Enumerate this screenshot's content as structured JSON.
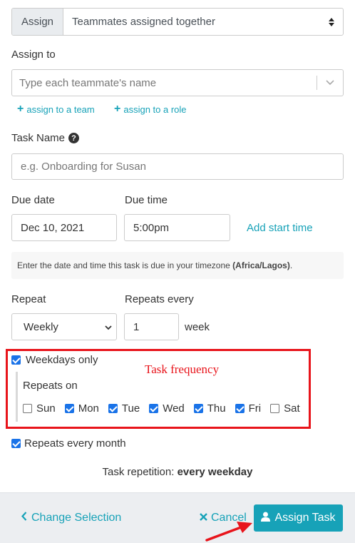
{
  "assign": {
    "addon_label": "Assign",
    "select_value": "Teammates assigned together"
  },
  "assign_to": {
    "label": "Assign to",
    "placeholder": "Type each teammate's name",
    "add_team": "assign to a team",
    "add_role": "assign to a role"
  },
  "task_name": {
    "label": "Task Name",
    "placeholder": "e.g. Onboarding for Susan"
  },
  "due": {
    "date_label": "Due date",
    "date_value": "Dec 10, 2021",
    "time_label": "Due time",
    "time_value": "5:00pm",
    "add_start_time": "Add start time"
  },
  "timezone_note": {
    "text": "Enter the date and time this task is due in your timezone",
    "tz": "(Africa/Lagos)",
    "suffix": "."
  },
  "repeat": {
    "label": "Repeat",
    "value": "Weekly",
    "every_label": "Repeats every",
    "every_value": "1",
    "unit": "week"
  },
  "weekdays_only": {
    "label": "Weekdays only",
    "checked": true
  },
  "annotation": {
    "text": "Task frequency",
    "color": "#e8141b"
  },
  "repeats_on": {
    "label": "Repeats on",
    "days": [
      {
        "label": "Sun",
        "checked": false
      },
      {
        "label": "Mon",
        "checked": true
      },
      {
        "label": "Tue",
        "checked": true
      },
      {
        "label": "Wed",
        "checked": true
      },
      {
        "label": "Thu",
        "checked": true
      },
      {
        "label": "Fri",
        "checked": true
      },
      {
        "label": "Sat",
        "checked": false
      }
    ]
  },
  "repeats_every_month": {
    "label": "Repeats every month",
    "checked": true
  },
  "summary": {
    "prefix": "Task repetition:",
    "value": "every weekday"
  },
  "footer": {
    "change_selection": "Change Selection",
    "cancel": "Cancel",
    "assign_task": "Assign Task"
  },
  "colors": {
    "accent": "#17a2b8",
    "checkbox": "#1a73e8",
    "highlight": "#e8141b"
  }
}
